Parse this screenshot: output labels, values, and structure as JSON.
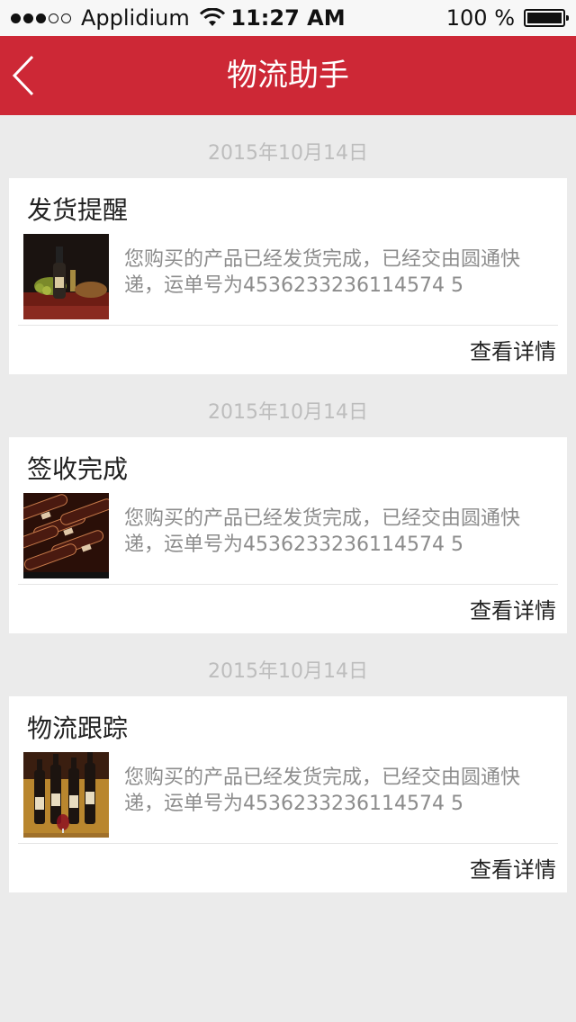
{
  "status_bar": {
    "carrier": "Applidium",
    "time": "11:27 AM",
    "battery_text": "100 %",
    "signal_bars_filled": 3,
    "signal_bars_total": 5
  },
  "nav": {
    "title": "物流助手",
    "back_icon": "chevron-left-icon"
  },
  "colors": {
    "nav_background": "#cd2836",
    "page_background": "#ebebeb"
  },
  "messages": [
    {
      "date": "2015年10月14日",
      "title": "发货提醒",
      "description": "您购买的产品已经发货完成，已经交由圆通快递，运单号为4536233236114574 5",
      "link": "查看详情",
      "thumbnail": "wine-bottle-still-life-photo"
    },
    {
      "date": "2015年10月14日",
      "title": "签收完成",
      "description": "您购买的产品已经发货完成，已经交由圆通快递，运单号为4536233236114574 5",
      "link": "查看详情",
      "thumbnail": "wine-cellar-bottles-photo"
    },
    {
      "date": "2015年10月14日",
      "title": "物流跟踪",
      "description": "您购买的产品已经发货完成，已经交由圆通快递，运单号为4536233236114574 5",
      "link": "查看详情",
      "thumbnail": "wine-bottles-glasses-photo"
    }
  ]
}
